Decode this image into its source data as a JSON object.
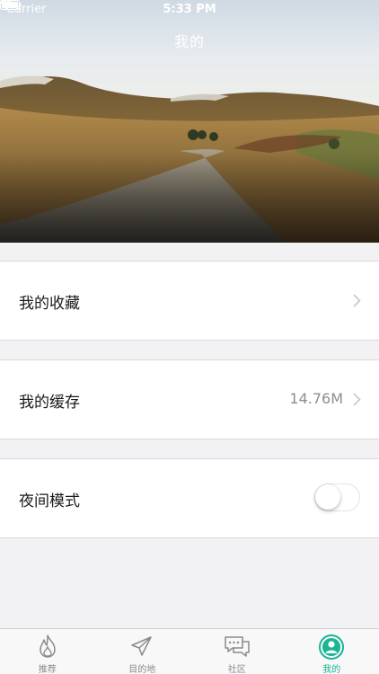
{
  "status_bar": {
    "carrier": "Carrier",
    "time": "5:33 PM"
  },
  "nav": {
    "title": "我的"
  },
  "rows": {
    "favorites": {
      "label": "我的收藏"
    },
    "cache": {
      "label": "我的缓存",
      "value": "14.76M"
    },
    "night_mode": {
      "label": "夜间模式",
      "enabled": false
    }
  },
  "tabbar": {
    "items": [
      {
        "label": "推荐",
        "icon": "flame-icon"
      },
      {
        "label": "目的地",
        "icon": "paper-plane-icon"
      },
      {
        "label": "社区",
        "icon": "chat-bubbles-icon"
      },
      {
        "label": "我的",
        "icon": "profile-icon",
        "active": true
      }
    ],
    "active_color": "#19b596"
  }
}
